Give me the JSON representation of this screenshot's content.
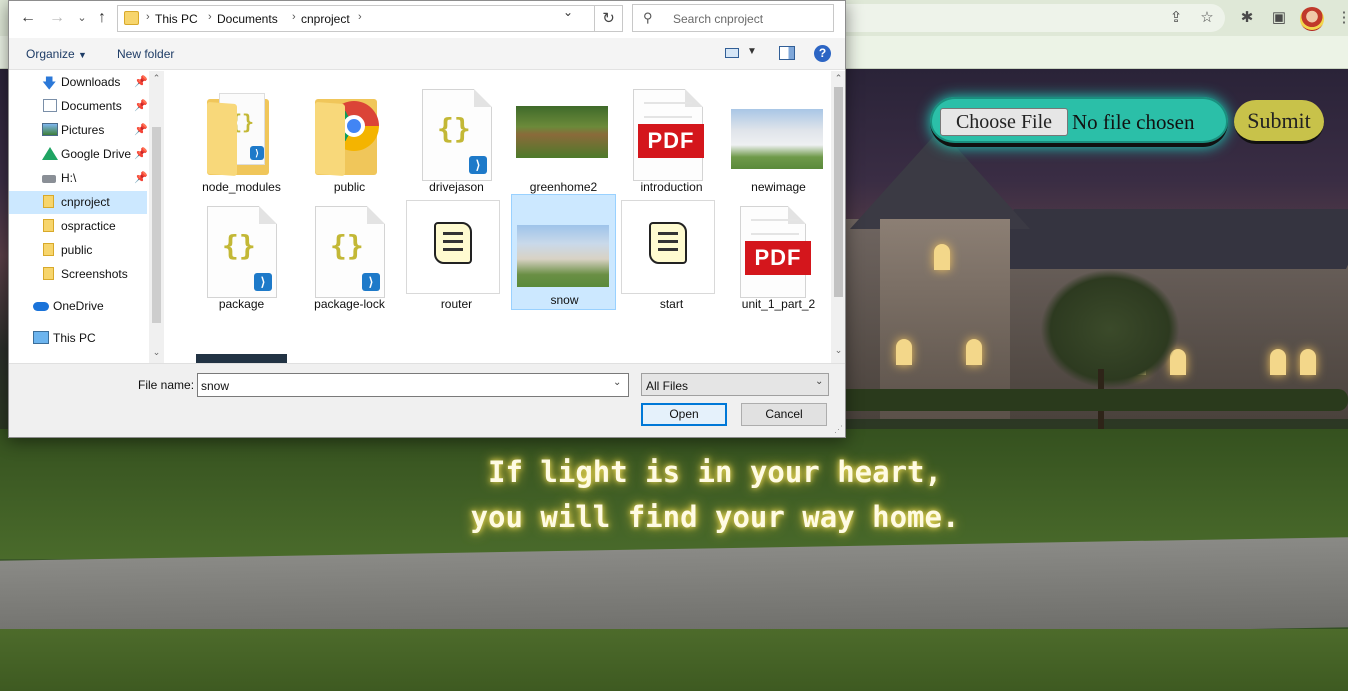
{
  "browser": {
    "icons": [
      "share-icon",
      "star-icon",
      "extensions-icon",
      "side-panel-icon",
      "profile-avatar",
      "more-icon"
    ]
  },
  "page": {
    "choose_file_label": "Choose File",
    "no_file_text": "No file chosen",
    "submit_label": "Submit",
    "quote_line1": "If light is in your heart,",
    "quote_line2": "you will find your way home."
  },
  "dialog": {
    "breadcrumb": [
      "This PC",
      "Documents",
      "cnproject"
    ],
    "search_placeholder": "Search cnproject",
    "toolbar": {
      "organize_label": "Organize",
      "new_folder_label": "New folder"
    },
    "sidebar": [
      {
        "label": "Downloads",
        "icon": "download-icon",
        "pinned": true
      },
      {
        "label": "Documents",
        "icon": "documents-icon",
        "pinned": true
      },
      {
        "label": "Pictures",
        "icon": "pictures-icon",
        "pinned": true
      },
      {
        "label": "Google Drive",
        "icon": "google-drive-icon",
        "pinned": true
      },
      {
        "label": "H:\\",
        "icon": "drive-icon",
        "pinned": true
      },
      {
        "label": "cnproject",
        "icon": "folder-icon",
        "selected": true
      },
      {
        "label": "ospractice",
        "icon": "folder-icon"
      },
      {
        "label": "public",
        "icon": "folder-icon"
      },
      {
        "label": "Screenshots",
        "icon": "folder-icon"
      },
      {
        "label": "OneDrive",
        "icon": "onedrive-icon"
      },
      {
        "label": "This PC",
        "icon": "pc-icon"
      }
    ],
    "files": [
      {
        "name": "node_modules",
        "kind": "folder-vscode"
      },
      {
        "name": "public",
        "kind": "folder-chrome"
      },
      {
        "name": "drivejason",
        "kind": "json"
      },
      {
        "name": "greenhome2",
        "kind": "image"
      },
      {
        "name": "introduction",
        "kind": "pdf"
      },
      {
        "name": "newimage",
        "kind": "image"
      },
      {
        "name": "package",
        "kind": "json"
      },
      {
        "name": "package-lock",
        "kind": "json"
      },
      {
        "name": "router",
        "kind": "script"
      },
      {
        "name": "snow",
        "kind": "image",
        "selected": true
      },
      {
        "name": "start",
        "kind": "script"
      },
      {
        "name": "unit_1_part_2",
        "kind": "pdf"
      }
    ],
    "pdf_badge": "PDF",
    "file_name_label": "File name:",
    "file_name_value": "snow",
    "file_type_value": "All Files",
    "open_label": "Open",
    "cancel_label": "Cancel"
  }
}
